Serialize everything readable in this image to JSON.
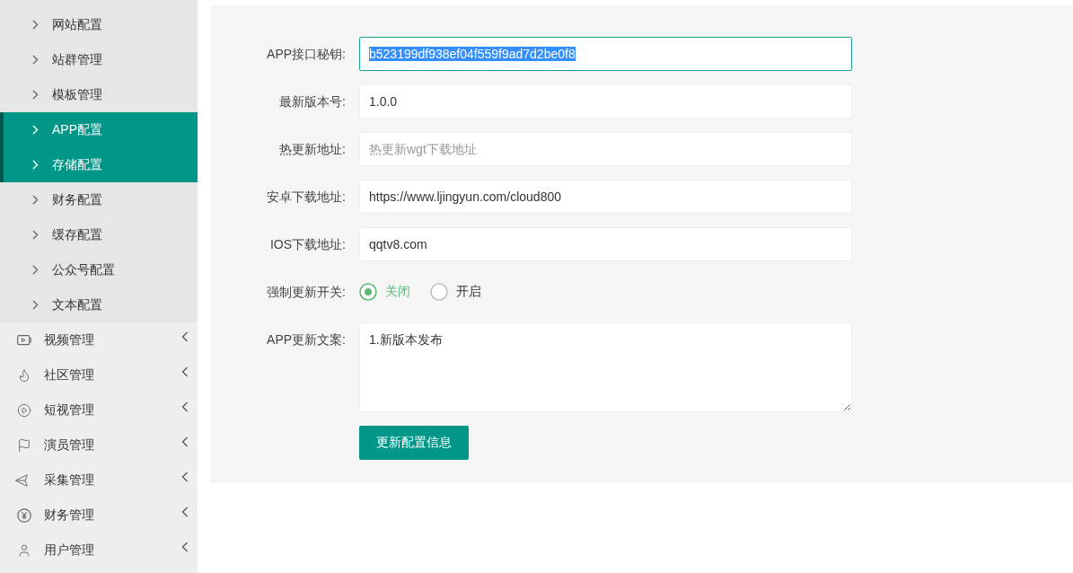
{
  "sidebar": {
    "sub_items": [
      {
        "label": "网站配置",
        "selected": false
      },
      {
        "label": "站群管理",
        "selected": false
      },
      {
        "label": "模板管理",
        "selected": false
      },
      {
        "label": "APP配置",
        "selected": true
      },
      {
        "label": "存储配置",
        "selected": true
      },
      {
        "label": "财务配置",
        "selected": false
      },
      {
        "label": "缓存配置",
        "selected": false
      },
      {
        "label": "公众号配置",
        "selected": false
      },
      {
        "label": "文本配置",
        "selected": false
      }
    ],
    "menus": [
      {
        "label": "视频管理",
        "expanded": false
      },
      {
        "label": "社区管理",
        "expanded": false
      },
      {
        "label": "短视管理",
        "expanded": false
      },
      {
        "label": "演员管理",
        "expanded": false
      },
      {
        "label": "采集管理",
        "expanded": false
      },
      {
        "label": "财务管理",
        "expanded": false
      },
      {
        "label": "用户管理",
        "expanded": false
      }
    ]
  },
  "form": {
    "fields": [
      {
        "kind": "text",
        "label": "APP接口秘钥:",
        "value": "b523199df938ef04f559f9ad7d2be0f8",
        "focused": true,
        "text_selected": true
      },
      {
        "kind": "text",
        "label": "最新版本号:",
        "value": "1.0.0",
        "focused": false,
        "text_selected": false
      },
      {
        "kind": "text",
        "label": "热更新地址:",
        "placeholder": "热更新wgt下载地址",
        "focused": false,
        "text_selected": false
      },
      {
        "kind": "text",
        "label": "安卓下载地址:",
        "value": "https://www.ljingyun.com/cloud800",
        "focused": false,
        "text_selected": false
      },
      {
        "kind": "text",
        "label": "IOS下载地址:",
        "value": "qqtv8.com",
        "focused": false,
        "text_selected": false
      },
      {
        "kind": "radio",
        "label": "强制更新开关:",
        "options": [
          {
            "label": "关闭",
            "selected": true
          },
          {
            "label": "开启",
            "selected": false
          }
        ]
      },
      {
        "kind": "textarea",
        "label": "APP更新文案:",
        "value": "1.新版本发布"
      }
    ],
    "submit_button": "更新配置信息"
  }
}
